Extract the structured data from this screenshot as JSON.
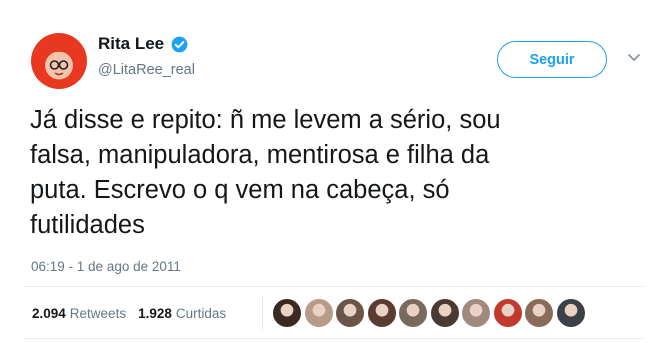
{
  "author": {
    "name": "Rita Lee",
    "handle": "@LitaRee_real",
    "verified": true,
    "avatar_icon": "profile-avatar-red-hair"
  },
  "follow_button": {
    "label": "Seguir"
  },
  "tweet": {
    "text": "Já disse e repito: ñ me levem a sério, sou\nfalsa, manipuladora, mentirosa e  filha da\nputa. Escrevo o q vem na cabeça, só\nfutilidades",
    "timestamp": "06:19 - 1 de ago de 2011"
  },
  "stats": {
    "retweets_count": "2.094",
    "retweets_label": "Retweets",
    "likes_count": "1.928",
    "likes_label": "Curtidas"
  },
  "likers": [
    {
      "icon": "liker-avatar",
      "color": "#3a2a22"
    },
    {
      "icon": "liker-avatar",
      "color": "#b89a88"
    },
    {
      "icon": "liker-avatar",
      "color": "#6b5448"
    },
    {
      "icon": "liker-avatar",
      "color": "#5a3c30"
    },
    {
      "icon": "liker-avatar",
      "color": "#7a6a5e"
    },
    {
      "icon": "liker-avatar",
      "color": "#4b3a32"
    },
    {
      "icon": "liker-avatar",
      "color": "#a08a80"
    },
    {
      "icon": "liker-avatar",
      "color": "#c23a2e"
    },
    {
      "icon": "liker-avatar",
      "color": "#8a6a58"
    },
    {
      "icon": "liker-avatar",
      "color": "#3c4048"
    }
  ],
  "colors": {
    "accent": "#1da1f2",
    "secondary_text": "#657786",
    "primary_text": "#14171a",
    "divider": "#e6ecf0"
  }
}
